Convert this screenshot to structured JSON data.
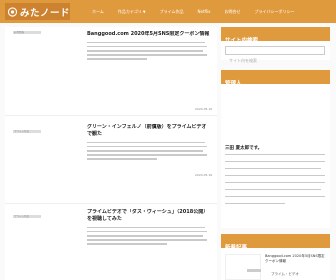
{
  "header": {
    "logo_text": "みたノード",
    "nav": [
      "ホーム",
      "作品カテゴリ",
      "プライム作品",
      "Netflix",
      "お問合せ",
      "プライバシーポリシー"
    ],
    "accent": "#e09a3e"
  },
  "posts": [
    {
      "category": "お得情報",
      "title": "Banggood.com 2020年5月SNS限定クーポン情報",
      "date": "2020.05.16"
    },
    {
      "category": "プライム作品",
      "title": "グリーン・インフェルノ（前償版）をプライムビデオで観た",
      "date": "2020.05.16"
    },
    {
      "category": "プライム作品",
      "title": "プライムビデオで「ダス・ヴィーシュ」（2018公開）を視聴してみた",
      "date": "2020.05.16"
    }
  ],
  "sidebar": {
    "search_heading": "サイト内検索",
    "search_placeholder": "サイト内を検索",
    "profile_heading": "管理人",
    "profile_name": "三田 夏太郎です。",
    "recent_heading": "新着記事",
    "recent_title": "Banggood.com 2020年5月SNS限定クーポン情報",
    "recent_category": "プライム・ビデオ"
  }
}
